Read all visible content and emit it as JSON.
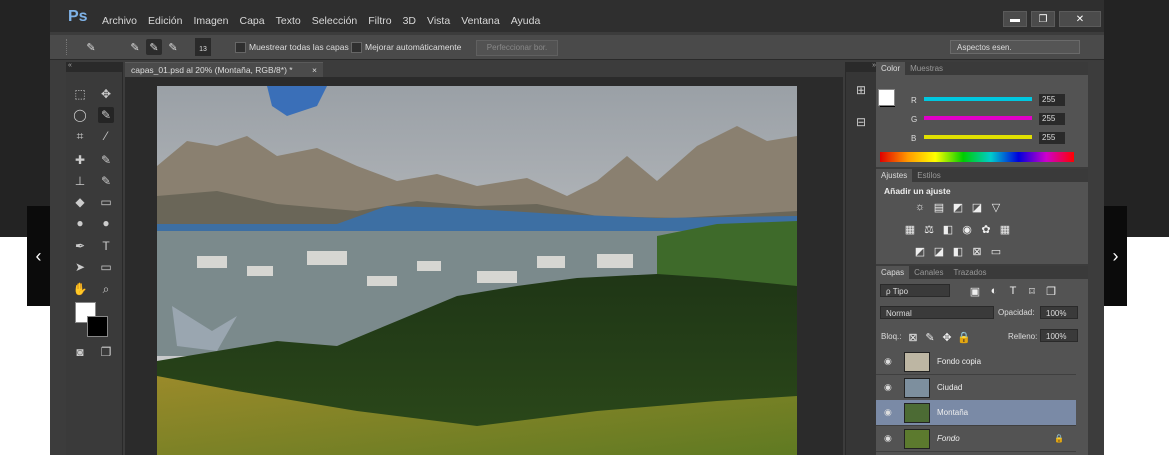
{
  "app": {
    "logo": "Ps",
    "menu": [
      "Archivo",
      "Edición",
      "Imagen",
      "Capa",
      "Texto",
      "Selección",
      "Filtro",
      "3D",
      "Vista",
      "Ventana",
      "Ayuda"
    ],
    "window_buttons": {
      "minimize": "▬",
      "restore": "❐",
      "close": "✕"
    }
  },
  "options_bar": {
    "brush_size": "13",
    "sample_all_layers": "Muestrear todas las capas",
    "auto_enhance": "Mejorar automáticamente",
    "refine_edge": "Perfeccionar bor.",
    "workspace": "Aspectos esen."
  },
  "document": {
    "tab_title": "capas_01.psd al 20% (Montaña, RGB/8*) *",
    "tab_close": "×"
  },
  "color_panel": {
    "tabs": [
      "Color",
      "Muestras"
    ],
    "channels": [
      {
        "label": "R",
        "value": "255",
        "color": "#00c8e0"
      },
      {
        "label": "G",
        "value": "255",
        "color": "#e000c8"
      },
      {
        "label": "B",
        "value": "255",
        "color": "#e0e000"
      }
    ]
  },
  "adjustments_panel": {
    "tabs": [
      "Ajustes",
      "Estilos"
    ],
    "title": "Añadir un ajuste"
  },
  "layers_panel": {
    "tabs": [
      "Capas",
      "Canales",
      "Trazados"
    ],
    "filter_kind": "ρ Tipo",
    "blend_mode": "Normal",
    "opacity_label": "Opacidad:",
    "opacity_value": "100%",
    "lock_label": "Bloq.:",
    "fill_label": "Relleno:",
    "fill_value": "100%",
    "layers": [
      {
        "name": "Fondo copia",
        "selected": false,
        "locked": false
      },
      {
        "name": "Ciudad",
        "selected": false,
        "locked": false
      },
      {
        "name": "Montaña",
        "selected": true,
        "locked": false
      },
      {
        "name": "Fondo",
        "selected": false,
        "locked": true
      }
    ]
  },
  "nav": {
    "prev": "‹",
    "next": "›"
  }
}
